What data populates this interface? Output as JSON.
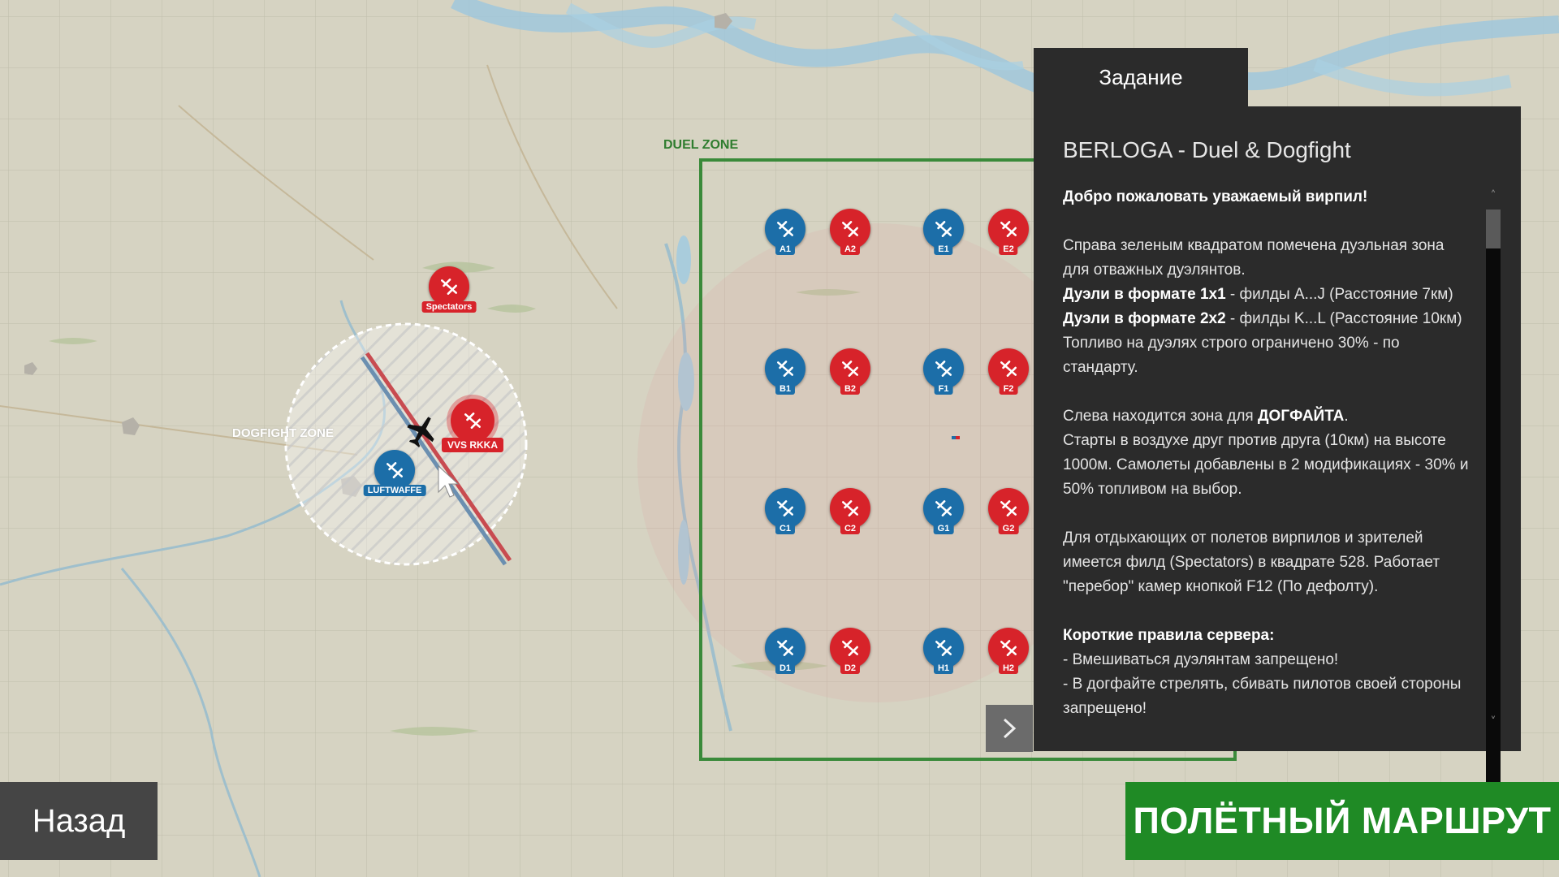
{
  "zones": {
    "duel_label": "DUEL ZONE",
    "dogfight_label": "DOGFIGHT ZONE"
  },
  "colors": {
    "allied": "#d7232a",
    "axis": "#1c6ea8",
    "duel_zone_border": "#3a8a3a",
    "panel_bg": "#2b2b2b",
    "route_button": "#1f8a25"
  },
  "airfields": {
    "spectators": "Spectators",
    "vvs": "VVS RKKA",
    "luftwaffe": "LUFTWAFFE",
    "duel": [
      "A1",
      "A2",
      "E1",
      "E2",
      "B1",
      "B2",
      "F1",
      "F2",
      "C1",
      "C2",
      "G1",
      "G2",
      "D1",
      "D2",
      "H1",
      "H2"
    ]
  },
  "panel": {
    "tab_label": "Задание",
    "title": "BERLOGA - Duel & Dogfight",
    "greeting": "Добро пожаловать уважаемый вирпил!",
    "p1_line1": "Справа зеленым квадратом помечена дуэльная зона для отважных дуэлянтов.",
    "p1_duel1_bold": "Дуэли в формате 1х1",
    "p1_duel1_rest": " - филды A...J (Расстояние 7км)",
    "p1_duel2_bold": "Дуэли в формате 2х2",
    "p1_duel2_rest": " - филды K...L (Расстояние 10км)",
    "p1_fuel": "Топливо на дуэлях строго ограничено 30% - по стандарту.",
    "p2_prefix": "Слева находится зона для ",
    "p2_bold": "ДОГФАЙТА",
    "p2_suffix": ".",
    "p2_rest": "Старты в воздухе друг против друга (10км) на высоте 1000м. Самолеты добавлены в 2 модификациях - 30% и 50% топливом на выбор.",
    "p3": "Для отдыхающих от полетов вирпилов и зрителей имеется филд (Spectators) в квадрате 528. Работает \"перебор\" камер кнопкой F12 (По дефолту).",
    "rules_title": "Короткие правила сервера:",
    "rule1": " - Вмешиваться дуэлянтам запрещено!",
    "rule2": " - В догфайте стрелять, сбивать пилотов своей стороны запрещено!"
  },
  "buttons": {
    "back": "Назад",
    "route": "ПОЛЁТНЫЙ МАРШРУТ"
  },
  "icons": {
    "airfield": "plane-icon",
    "next": "chevron-right-icon",
    "scroll_up": "chevron-up-icon",
    "scroll_down": "chevron-down-icon"
  }
}
